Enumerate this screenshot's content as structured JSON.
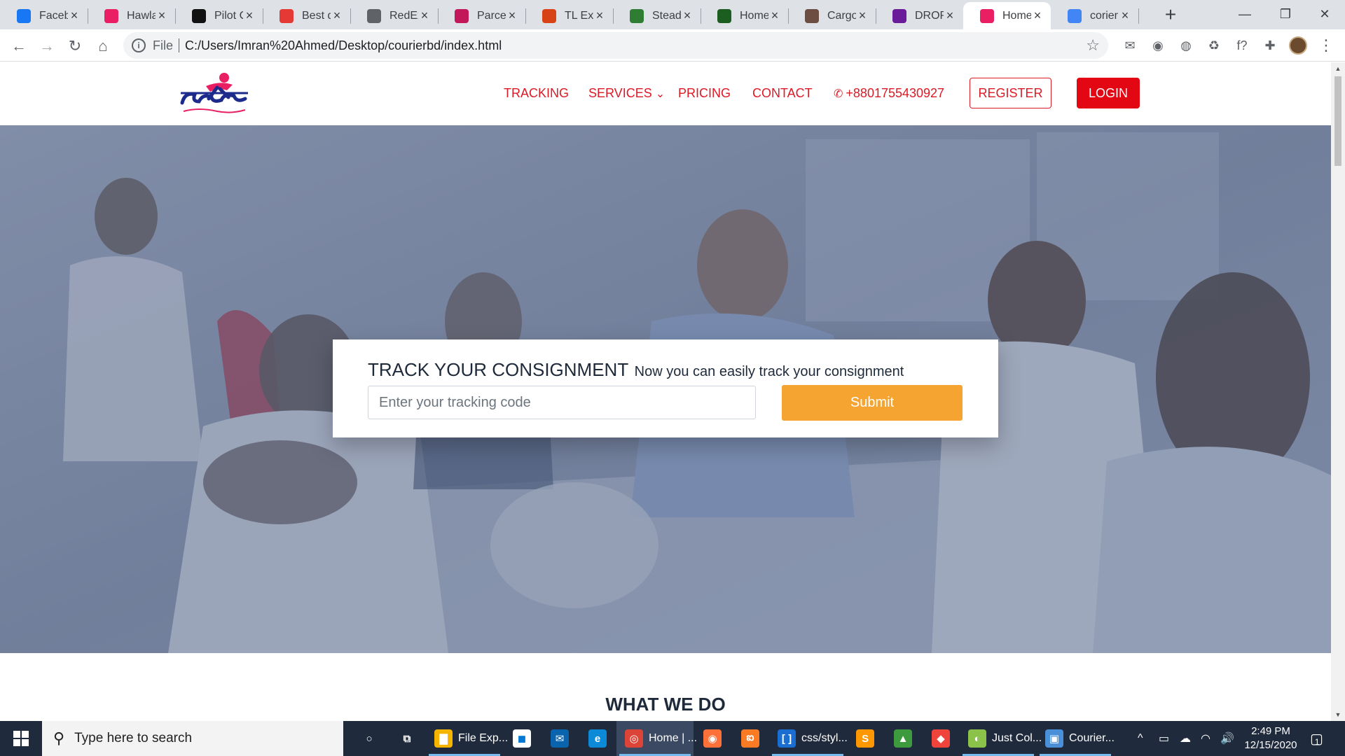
{
  "browser": {
    "tabs": [
      {
        "label": "Facebo",
        "favicon": "facebook-icon",
        "color": "#1877f2"
      },
      {
        "label": "Hawlac",
        "favicon": "runner-logo-icon",
        "color": "#e91e63"
      },
      {
        "label": "Pilot C",
        "favicon": "pilot-logo-icon",
        "color": "#111111"
      },
      {
        "label": "Best d",
        "favicon": "x-logo-icon",
        "color": "#e53935"
      },
      {
        "label": "RedEx",
        "favicon": "globe-icon",
        "color": "#5f6368"
      },
      {
        "label": "Parcel",
        "favicon": "parcel-logo-icon",
        "color": "#c2185b"
      },
      {
        "label": "TL Exp",
        "favicon": "tl-logo-icon",
        "color": "#d84315"
      },
      {
        "label": "Steadf",
        "favicon": "steadfast-logo-icon",
        "color": "#2e7d32"
      },
      {
        "label": "Home",
        "favicon": "courier-logo-icon",
        "color": "#1b5e20"
      },
      {
        "label": "Cargo",
        "favicon": "cargo-logo-icon",
        "color": "#6d4c41"
      },
      {
        "label": "DROPE",
        "favicon": "drop-logo-icon",
        "color": "#6a1b9a"
      },
      {
        "label": "Home",
        "favicon": "runner-logo-icon",
        "color": "#e91e63",
        "active": true
      },
      {
        "label": "corier",
        "favicon": "google-icon",
        "color": "#4285f4"
      }
    ],
    "new_tab_symbol": "+",
    "window_controls": {
      "minimize": "—",
      "maximize": "❐",
      "close": "✕"
    },
    "nav": {
      "back": "←",
      "forward": "→",
      "reload": "↻",
      "home": "⌂"
    },
    "omnibox": {
      "info_symbol": "i",
      "scheme_label": "File",
      "url": "C:/Users/Imran%20Ahmed/Desktop/courierbd/index.html",
      "star": "☆"
    },
    "extensions": [
      "mail-off-icon",
      "camera-icon",
      "globe-ext-icon",
      "recycle-icon",
      "function-icon",
      "puzzle-icon"
    ],
    "extension_glyphs": [
      "✉",
      "◉",
      "◍",
      "♻",
      "f?",
      "✚"
    ],
    "menu_symbol": "⋮"
  },
  "site": {
    "logo_alt": "হাউলাদার",
    "nav": {
      "tracking": "TRACKING",
      "services": "SERVICES",
      "services_caret": "⌄",
      "pricing": "PRICING",
      "contact": "CONTACT",
      "phone": "+8801755430927",
      "register": "REGISTER",
      "login": "LOGIN"
    },
    "tracker": {
      "title": "TRACK YOUR CONSIGNMENT",
      "subtitle": "Now you can easily track your consignment",
      "input_placeholder": "Enter your tracking code",
      "submit": "Submit"
    },
    "section_title": "WHAT WE DO",
    "colors": {
      "accent": "#dc1a26",
      "login_bg": "#e30613",
      "submit_bg": "#f5a431"
    }
  },
  "scrollbar": {
    "up": "▲",
    "down": "▼"
  },
  "taskbar": {
    "search_placeholder": "Type here to search",
    "apps": [
      {
        "label": "",
        "icon": "cortana-icon",
        "glyph": "○",
        "color": "transparent"
      },
      {
        "label": "",
        "icon": "task-view-icon",
        "glyph": "⧉",
        "color": "transparent"
      },
      {
        "label": "File Exp...",
        "icon": "folder-icon",
        "glyph": "▇",
        "color": "#f4b400",
        "running": true
      },
      {
        "label": "",
        "icon": "store-icon",
        "glyph": "◼",
        "color": "#ffffff"
      },
      {
        "label": "",
        "icon": "mail-icon",
        "glyph": "✉",
        "color": "#0a64ad"
      },
      {
        "label": "",
        "icon": "edge-icon",
        "glyph": "e",
        "color": "#0c8ad8"
      },
      {
        "label": "Home | ...",
        "icon": "chrome-icon",
        "glyph": "◎",
        "color": "#db4437",
        "running": true,
        "active": true
      },
      {
        "label": "",
        "icon": "firefox-icon",
        "glyph": "◉",
        "color": "#ff7139"
      },
      {
        "label": "",
        "icon": "xampp-icon",
        "glyph": "ఐ",
        "color": "#fb7a24"
      },
      {
        "label": "css/styl...",
        "icon": "brackets-icon",
        "glyph": "[ ]",
        "color": "#1a6dd1",
        "running": true
      },
      {
        "label": "",
        "icon": "sublime-icon",
        "glyph": "S",
        "color": "#ff9800"
      },
      {
        "label": "",
        "icon": "photo-icon",
        "glyph": "▲",
        "color": "#3d9a3d"
      },
      {
        "label": "",
        "icon": "anydesk-icon",
        "glyph": "◆",
        "color": "#ef443b"
      },
      {
        "label": "Just Col...",
        "icon": "just-color-picker-icon",
        "glyph": "◐",
        "color": "#8bc34a",
        "running": true
      },
      {
        "label": "Courier...",
        "icon": "image-viewer-icon",
        "glyph": "▣",
        "color": "#4a90d9",
        "running": true
      }
    ],
    "tray_glyphs": [
      "^",
      "▭",
      "☁",
      "◠",
      "🔊"
    ],
    "time": "2:49 PM",
    "date": "12/15/2020",
    "notification_count": "1"
  }
}
